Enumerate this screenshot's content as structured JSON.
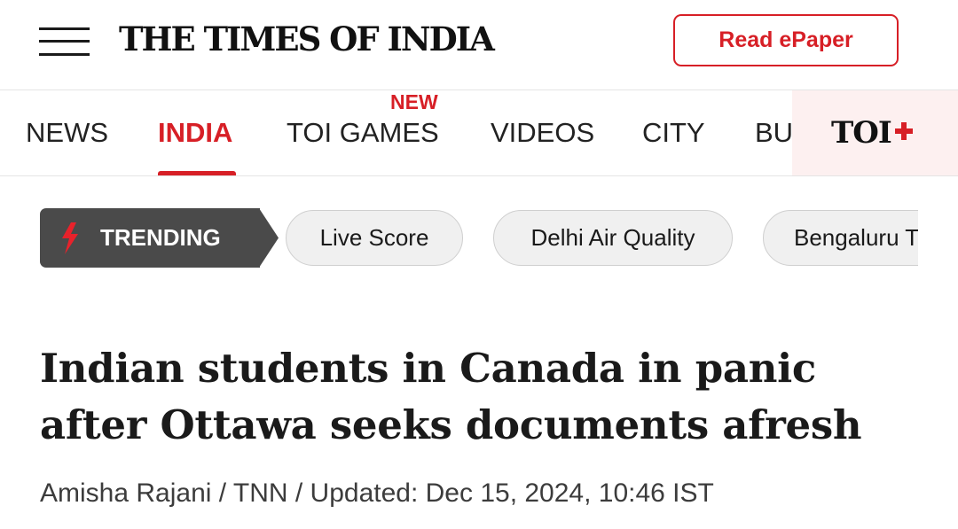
{
  "header": {
    "logo": "THE TIMES OF INDIA",
    "epaper_label": "Read ePaper",
    "accent_color": "#d71f26"
  },
  "nav": {
    "items": [
      {
        "label": "NEWS",
        "active": false
      },
      {
        "label": "INDIA",
        "active": true
      },
      {
        "label": "TOI GAMES",
        "active": false,
        "badge": "NEW"
      },
      {
        "label": "VIDEOS",
        "active": false
      },
      {
        "label": "CITY",
        "active": false
      },
      {
        "label": "BU",
        "active": false
      }
    ],
    "toi_plus": "TOI"
  },
  "trending": {
    "label": "TRENDING",
    "icon": "lightning-icon",
    "pills": [
      "Live Score",
      "Delhi Air Quality",
      "Bengaluru T"
    ]
  },
  "article": {
    "headline": "Indian students in Canada in panic after Ottawa seeks documents afresh",
    "byline": "Amisha Rajani / TNN / Updated: Dec 15, 2024, 10:46 IST"
  }
}
